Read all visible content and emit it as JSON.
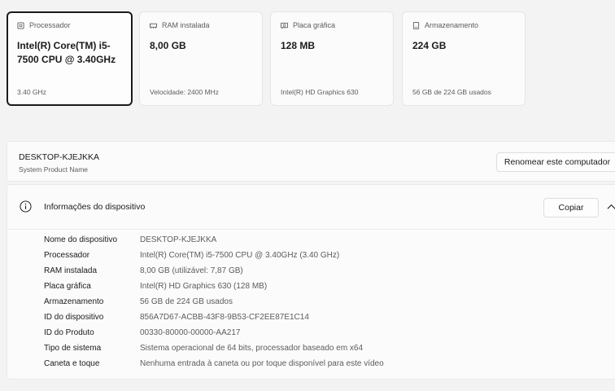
{
  "cards": [
    {
      "title": "Processador",
      "icon": "processor-icon",
      "value": "Intel(R) Core(TM) i5-7500 CPU @ 3.40GHz",
      "sub": "3.40 GHz"
    },
    {
      "title": "RAM instalada",
      "icon": "ram-icon",
      "value": "8,00 GB",
      "sub": "Velocidade: 2400 MHz"
    },
    {
      "title": "Placa gráfica",
      "icon": "graphics-card-icon",
      "value": "128 MB",
      "sub": "Intel(R) HD Graphics 630"
    },
    {
      "title": "Armazenamento",
      "icon": "storage-icon",
      "value": "224 GB",
      "sub": "56 GB de 224 GB usados"
    }
  ],
  "computer": {
    "name": "DESKTOP-KJEJKKA",
    "model": "System Product Name",
    "rename_label": "Renomear este computador"
  },
  "device_info": {
    "title": "Informações do dispositivo",
    "copy_label": "Copiar",
    "rows": [
      {
        "label": "Nome do dispositivo",
        "value": "DESKTOP-KJEJKKA"
      },
      {
        "label": "Processador",
        "value": "Intel(R) Core(TM) i5-7500 CPU @ 3.40GHz (3.40 GHz)"
      },
      {
        "label": "RAM instalada",
        "value": "8,00 GB (utilizável: 7,87 GB)"
      },
      {
        "label": "Placa gráfica",
        "value": "Intel(R) HD Graphics 630 (128 MB)"
      },
      {
        "label": "Armazenamento",
        "value": "56 GB de 224 GB usados"
      },
      {
        "label": "ID do dispositivo",
        "value": "856A7D67-ACBB-43F8-9B53-CF2EE87E1C14"
      },
      {
        "label": "ID do Produto",
        "value": "00330-80000-00000-AA217"
      },
      {
        "label": "Tipo de sistema",
        "value": "Sistema operacional de 64 bits, processador baseado em x64"
      },
      {
        "label": "Caneta e toque",
        "value": "Nenhuma entrada à caneta ou por toque disponível para este vídeo"
      }
    ]
  }
}
